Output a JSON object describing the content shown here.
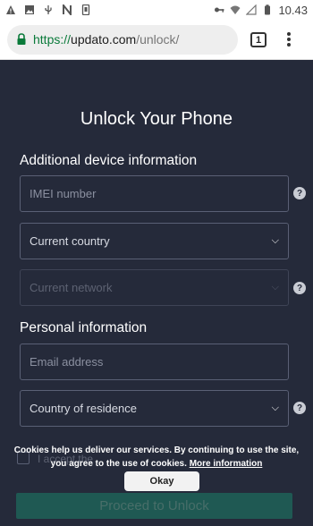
{
  "status_bar": {
    "time": "10.43",
    "icons_left": [
      "warning-icon",
      "image-icon",
      "usb-icon",
      "n-icon",
      "storage-icon"
    ],
    "icons_right": [
      "key-icon",
      "wifi-icon",
      "signal-icon",
      "battery-icon"
    ]
  },
  "browser": {
    "url_scheme": "https://",
    "url_host": "updato.com",
    "url_path": "/unlock/",
    "tab_count": "1"
  },
  "page": {
    "title": "Unlock Your Phone",
    "device_section": "Additional device information",
    "personal_section": "Personal information",
    "fields": {
      "imei": "IMEI number",
      "country": "Current country",
      "network": "Current network",
      "email": "Email address",
      "residence": "Country of residence"
    },
    "help": "?",
    "accept": "I accept the",
    "proceed": "Proceed to Unlock"
  },
  "cookie": {
    "line1": "Cookies help us deliver our services. By continuing to use the site,",
    "line2": "you agree to the use of cookies.",
    "more": "More information",
    "okay": "Okay"
  },
  "colors": {
    "background": "#252a3a",
    "accent_green": "#1f5953",
    "url_green": "#0a7a3a"
  }
}
